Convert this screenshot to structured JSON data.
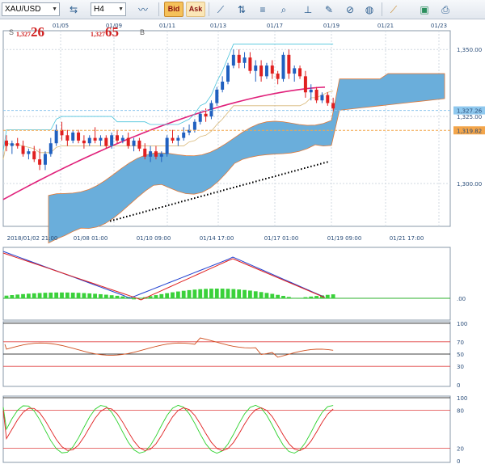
{
  "toolbar": {
    "symbol": "XAU/USD",
    "timeframe": "H4",
    "bid_label": "Bid",
    "ask_label": "Ask",
    "icons": [
      "currency-icon",
      "line-chart-icon",
      "trend-icon",
      "horizontal-line-icon",
      "fibonacci-icon",
      "zoom-icon",
      "vertical-line-icon",
      "note-icon",
      "compass-icon",
      "globe-icon",
      "ruler-icon",
      "screenshot-icon",
      "print-icon"
    ]
  },
  "quote": {
    "sell_label": "S",
    "sell_prefix": "1,327",
    "sell_big": "26",
    "buy_label": "B",
    "buy_prefix": "1,327",
    "buy_big": "65"
  },
  "colors": {
    "bull": "#2060c0",
    "bear": "#e02020",
    "cloud": "#6aaedb",
    "ma_pink": "#e0207a",
    "grid": "#d0d8e0",
    "badge_blue": "#8ec8ee",
    "badge_orange": "#f3a54a"
  },
  "price_axis": {
    "labels": [
      "1,350.00",
      "1,327.26",
      "1,325.00",
      "1,319.82",
      "1,300.00"
    ]
  },
  "top_dates": [
    "01/05",
    "01/09",
    "01/11",
    "01/13",
    "01/17",
    "01/19",
    "01/21",
    "01/23"
  ],
  "bottom_dates": [
    "2018/01/02 21:00",
    "01/08 01:00",
    "01/10 09:00",
    "01/14 17:00",
    "01/17 01:00",
    "01/19 09:00",
    "01/21 17:00"
  ],
  "macd_axis": {
    "zero": ".00"
  },
  "rsi_axis": {
    "labels": [
      "100",
      "70",
      "50",
      "30",
      "0"
    ]
  },
  "stoch_axis": {
    "labels": [
      "100",
      "80",
      "20",
      "0"
    ]
  },
  "chart_data": {
    "type": "candlestick",
    "symbol": "XAU/USD",
    "timeframe": "H4",
    "ylim": [
      1284,
      1357
    ],
    "current_price": 1327.26,
    "marked_level": 1319.82,
    "candles": [
      [
        1316,
        1318,
        1312,
        1314
      ],
      [
        1314,
        1316,
        1311,
        1315
      ],
      [
        1315,
        1317,
        1313,
        1314
      ],
      [
        1314,
        1316,
        1310,
        1311
      ],
      [
        1311,
        1313,
        1309,
        1312
      ],
      [
        1312,
        1314,
        1308,
        1309
      ],
      [
        1309,
        1313,
        1305,
        1307
      ],
      [
        1307,
        1312,
        1305,
        1311
      ],
      [
        1311,
        1317,
        1310,
        1315
      ],
      [
        1315,
        1322,
        1314,
        1320
      ],
      [
        1320,
        1323,
        1316,
        1318
      ],
      [
        1318,
        1320,
        1314,
        1316
      ],
      [
        1316,
        1320,
        1315,
        1319
      ],
      [
        1319,
        1320,
        1315,
        1316
      ],
      [
        1316,
        1318,
        1313,
        1315
      ],
      [
        1315,
        1318,
        1314,
        1317
      ],
      [
        1317,
        1321,
        1315,
        1316
      ],
      [
        1316,
        1318,
        1314,
        1317
      ],
      [
        1317,
        1318,
        1313,
        1314
      ],
      [
        1314,
        1319,
        1313,
        1318
      ],
      [
        1318,
        1320,
        1315,
        1316
      ],
      [
        1316,
        1318,
        1315,
        1317
      ],
      [
        1317,
        1319,
        1313,
        1314
      ],
      [
        1314,
        1317,
        1312,
        1316
      ],
      [
        1316,
        1317,
        1312,
        1313
      ],
      [
        1313,
        1315,
        1309,
        1310
      ],
      [
        1310,
        1314,
        1308,
        1312
      ],
      [
        1312,
        1314,
        1309,
        1310
      ],
      [
        1310,
        1312,
        1308,
        1311
      ],
      [
        1311,
        1318,
        1310,
        1317
      ],
      [
        1317,
        1320,
        1315,
        1316
      ],
      [
        1316,
        1318,
        1314,
        1317
      ],
      [
        1317,
        1321,
        1316,
        1319
      ],
      [
        1319,
        1322,
        1318,
        1320
      ],
      [
        1320,
        1324,
        1319,
        1323
      ],
      [
        1323,
        1327,
        1322,
        1326
      ],
      [
        1326,
        1328,
        1323,
        1325
      ],
      [
        1325,
        1331,
        1324,
        1330
      ],
      [
        1330,
        1336,
        1329,
        1335
      ],
      [
        1335,
        1340,
        1334,
        1338
      ],
      [
        1338,
        1345,
        1337,
        1344
      ],
      [
        1344,
        1350,
        1343,
        1348
      ],
      [
        1348,
        1350,
        1343,
        1345
      ],
      [
        1345,
        1349,
        1343,
        1347
      ],
      [
        1347,
        1349,
        1341,
        1342
      ],
      [
        1342,
        1346,
        1338,
        1344
      ],
      [
        1344,
        1346,
        1338,
        1340
      ],
      [
        1340,
        1345,
        1339,
        1344
      ],
      [
        1344,
        1346,
        1339,
        1341
      ],
      [
        1341,
        1342,
        1337,
        1339
      ],
      [
        1339,
        1349,
        1338,
        1348
      ],
      [
        1348,
        1350,
        1339,
        1341
      ],
      [
        1341,
        1344,
        1338,
        1343
      ],
      [
        1343,
        1344,
        1339,
        1340
      ],
      [
        1340,
        1342,
        1332,
        1334
      ],
      [
        1334,
        1337,
        1331,
        1335
      ],
      [
        1335,
        1336,
        1330,
        1331
      ],
      [
        1331,
        1334,
        1330,
        1333
      ],
      [
        1333,
        1334,
        1329,
        1330
      ],
      [
        1330,
        1332,
        1327,
        1328
      ]
    ],
    "rsi_levels": [
      70,
      50,
      30
    ],
    "stoch_levels": [
      80,
      20
    ]
  }
}
